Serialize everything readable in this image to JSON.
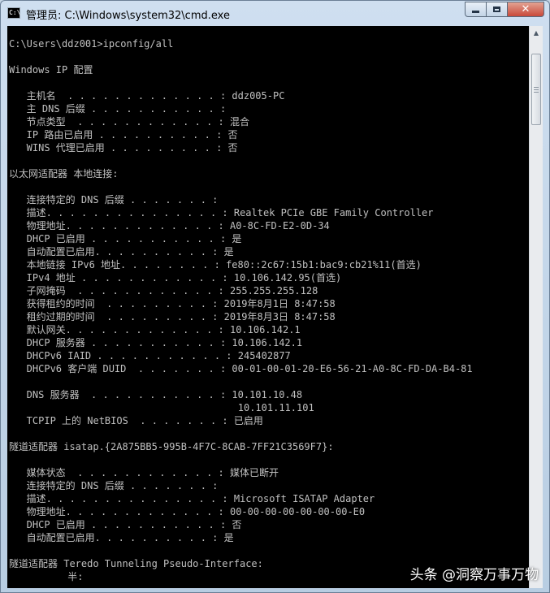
{
  "window": {
    "title": "管理员: C:\\Windows\\system32\\cmd.exe",
    "icon": "cmd-icon",
    "controls": {
      "minimize": "minimize-icon",
      "maximize": "maximize-icon",
      "close": "close-icon"
    }
  },
  "console": {
    "lines": [
      "C:\\Users\\ddz001>ipconfig/all",
      "",
      "Windows IP 配置",
      "",
      "   主机名  . . . . . . . . . . . . . : ddz005-PC",
      "   主 DNS 后缀 . . . . . . . . . . . :",
      "   节点类型  . . . . . . . . . . . . : 混合",
      "   IP 路由已启用 . . . . . . . . . . : 否",
      "   WINS 代理已启用 . . . . . . . . . : 否",
      "",
      "以太网适配器 本地连接:",
      "",
      "   连接特定的 DNS 后缀 . . . . . . . :",
      "   描述. . . . . . . . . . . . . . . : Realtek PCIe GBE Family Controller",
      "   物理地址. . . . . . . . . . . . . : A0-8C-FD-E2-0D-34",
      "   DHCP 已启用 . . . . . . . . . . . : 是",
      "   自动配置已启用. . . . . . . . . . : 是",
      "   本地链接 IPv6 地址. . . . . . . . : fe80::2c67:15b1:bac9:cb21%11(首选)",
      "   IPv4 地址 . . . . . . . . . . . . : 10.106.142.95(首选)",
      "   子网掩码  . . . . . . . . . . . . : 255.255.255.128",
      "   获得租约的时间  . . . . . . . . . : 2019年8月1日 8:47:58",
      "   租约过期的时间  . . . . . . . . . : 2019年8月3日 8:47:58",
      "   默认网关. . . . . . . . . . . . . : 10.106.142.1",
      "   DHCP 服务器 . . . . . . . . . . . : 10.106.142.1",
      "   DHCPv6 IAID . . . . . . . . . . . : 245402877",
      "   DHCPv6 客户端 DUID  . . . . . . . : 00-01-00-01-20-E6-56-21-A0-8C-FD-DA-B4-81",
      "",
      "   DNS 服务器  . . . . . . . . . . . : 10.101.10.48",
      "                                       10.101.11.101",
      "   TCPIP 上的 NetBIOS  . . . . . . . : 已启用",
      "",
      "隧道适配器 isatap.{2A875BB5-995B-4F7C-8CAB-7FF21C3569F7}:",
      "",
      "   媒体状态  . . . . . . . . . . . . : 媒体已断开",
      "   连接特定的 DNS 后缀 . . . . . . . :",
      "   描述. . . . . . . . . . . . . . . : Microsoft ISATAP Adapter",
      "   物理地址. . . . . . . . . . . . . : 00-00-00-00-00-00-00-E0",
      "   DHCP 已启用 . . . . . . . . . . . : 否",
      "   自动配置已启用. . . . . . . . . . : 是",
      "",
      "隧道适配器 Teredo Tunneling Pseudo-Interface:",
      "          半:"
    ]
  },
  "watermark": "头条 @洞察万事万物",
  "colors": {
    "console_bg": "#000000",
    "console_text": "#c0c0c0",
    "close_button": "#c9493a"
  }
}
